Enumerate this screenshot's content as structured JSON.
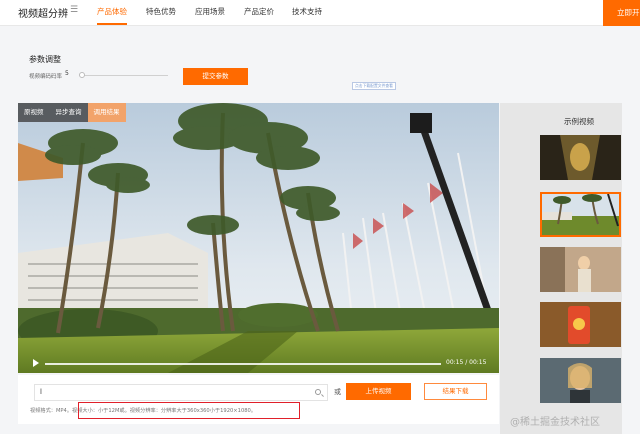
{
  "nav": {
    "brand": "视频超分辨",
    "brand_menu_icon": "menu-icon",
    "items": [
      "产品体验",
      "特色优势",
      "应用场景",
      "产品定价",
      "技术支持"
    ],
    "active_item": "产品体验",
    "cta": "立即开",
    "accent_color": "#ff6a00"
  },
  "params": {
    "title": "参数调整",
    "bitrate_label": "视频编码码率",
    "bitrate_value": "5",
    "submit": "提交参数",
    "tiny_link": "点击下载配置文件查看"
  },
  "player": {
    "tabs": [
      "原视频",
      "异步查询",
      "调用结果"
    ],
    "active_tab": "调用结果",
    "timecode": "00:15 / 00:15",
    "progress": 1.0
  },
  "upload": {
    "input_value": "l",
    "or": "或",
    "upload_button": "上传视频",
    "download_button": "结果下载",
    "hint": "视频格式：MP4。视频大小：小于12M或。视频分辨率：分辨率大于360x360小于1920×1080。"
  },
  "sidebar": {
    "title": "示例视频",
    "thumbnails": [
      "tunnel-thumbnail",
      "palm-hotel-thumbnail",
      "street-woman-thumbnail",
      "phone-hand-thumbnail",
      "woman-phone-thumbnail"
    ],
    "selected_index": 1
  },
  "watermark": "@稀土掘金技术社区"
}
